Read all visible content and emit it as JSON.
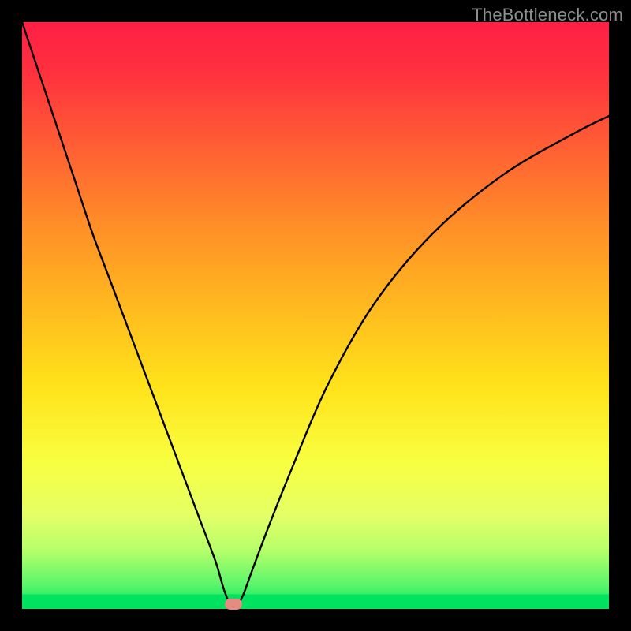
{
  "watermark": {
    "text": "TheBottleneck.com"
  },
  "colors": {
    "background": "#000000",
    "curve_stroke": "#000000",
    "marker_fill": "#e58b82",
    "watermark_text": "#8e8e8e",
    "gradient_top": "#ff1f45",
    "gradient_mid": "#ffe21a",
    "gradient_bottom": "#00e35e"
  },
  "chart_data": {
    "type": "line",
    "title": "",
    "xlabel": "",
    "ylabel": "",
    "xlim": [
      0,
      100
    ],
    "ylim": [
      0,
      100
    ],
    "grid": false,
    "legend": false,
    "series": [
      {
        "name": "bottleneck-curve",
        "x": [
          0,
          3,
          6,
          9,
          12,
          15,
          18,
          21,
          24,
          27,
          30,
          33,
          34.5,
          36,
          37.5,
          39,
          42,
          46,
          52,
          60,
          70,
          82,
          94,
          100
        ],
        "y": [
          100,
          91,
          82,
          73,
          64,
          56,
          48,
          40,
          32,
          24,
          16,
          8,
          3,
          0,
          2,
          6,
          14,
          24,
          38,
          52,
          64,
          74,
          81,
          84
        ]
      }
    ],
    "annotations": [
      {
        "name": "minimum-marker",
        "x": 36,
        "y": 0.8
      }
    ]
  }
}
